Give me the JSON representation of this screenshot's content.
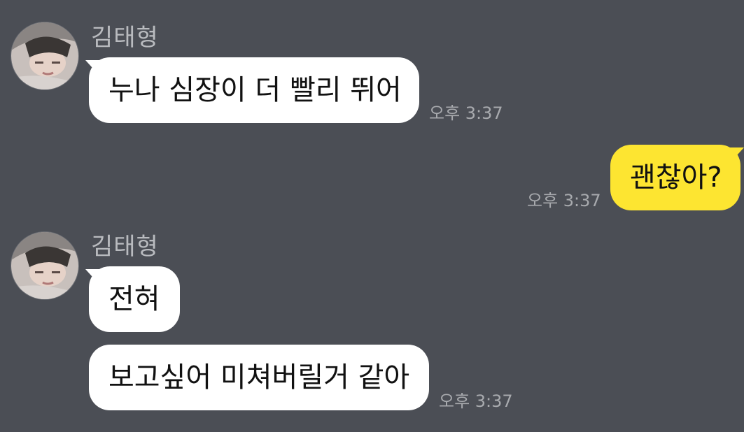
{
  "chat": {
    "messages": [
      {
        "sender": "김태형",
        "text": "누나 심장이 더 빨리 뛰어",
        "time": "오후 3:37"
      },
      {
        "sender": "me",
        "text": "괜찮아?",
        "time": "오후 3:37"
      },
      {
        "sender": "김태형",
        "text": "전혀"
      },
      {
        "sender": "김태형",
        "text": "보고싶어 미쳐버릴거 같아",
        "time": "오후 3:37"
      }
    ]
  },
  "colors": {
    "background": "#4b4e55",
    "incoming_bubble": "#ffffff",
    "outgoing_bubble": "#fde531",
    "sender_name": "#b9bbbf",
    "timestamp": "#a8aaae"
  }
}
